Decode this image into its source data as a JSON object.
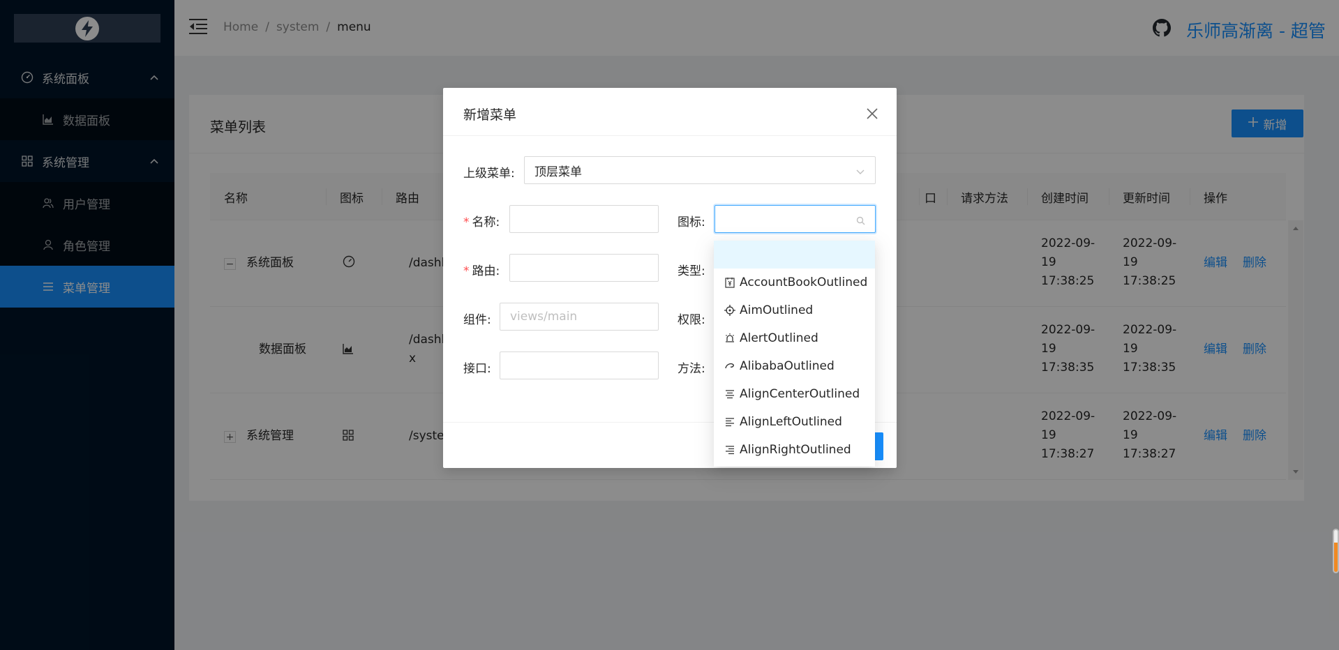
{
  "sidebar": {
    "groups": [
      {
        "label": "系统面板",
        "icon": "dashboard-icon"
      },
      {
        "label": "系统管理",
        "icon": "appstore-icon"
      }
    ],
    "items": [
      {
        "label": "数据面板",
        "icon": "area-chart-icon"
      },
      {
        "label": "用户管理",
        "icon": "team-icon"
      },
      {
        "label": "角色管理",
        "icon": "user-icon"
      },
      {
        "label": "菜单管理",
        "icon": "menu-icon"
      }
    ]
  },
  "header": {
    "breadcrumb": [
      "Home",
      "system",
      "menu"
    ],
    "separator": "/",
    "user_name": "乐师高渐离 - 超管"
  },
  "card": {
    "title": "菜单列表",
    "add_label": "新增"
  },
  "table": {
    "columns": [
      "名称",
      "图标",
      "路由",
      "口",
      "请求方法",
      "创建时间",
      "更新时间",
      "操作"
    ],
    "rows": [
      {
        "name": "系统面板",
        "expander": "−",
        "route": "/dashb",
        "route2": "",
        "created": [
          "2022-09-",
          "19",
          "17:38:25"
        ],
        "updated": [
          "2022-09-",
          "19",
          "17:38:25"
        ],
        "edit": "编辑",
        "delete": "删除"
      },
      {
        "name": "数据面板",
        "expander": "",
        "route": "/dashb",
        "route2": "x",
        "created": [
          "2022-09-",
          "19",
          "17:38:35"
        ],
        "updated": [
          "2022-09-",
          "19",
          "17:38:35"
        ],
        "edit": "编辑",
        "delete": "删除"
      },
      {
        "name": "系统管理",
        "expander": "+",
        "route": "/syster",
        "route2": "",
        "created": [
          "2022-09-",
          "19",
          "17:38:27"
        ],
        "updated": [
          "2022-09-",
          "19",
          "17:38:27"
        ],
        "edit": "编辑",
        "delete": "删除"
      }
    ]
  },
  "modal": {
    "title": "新增菜单",
    "parent_label": "上级菜单:",
    "parent_value": "顶层菜单",
    "name_label": "名称:",
    "icon_label": "图标:",
    "route_label": "路由:",
    "type_label": "类型:",
    "component_label": "组件:",
    "component_placeholder": "views/main",
    "permission_label": "权限:",
    "api_label": "接口:",
    "method_label": "方法:"
  },
  "icon_dropdown": {
    "options": [
      {
        "label": "",
        "icon": ""
      },
      {
        "label": "AccountBookOutlined",
        "icon": "account-book-icon"
      },
      {
        "label": "AimOutlined",
        "icon": "aim-icon"
      },
      {
        "label": "AlertOutlined",
        "icon": "alert-icon"
      },
      {
        "label": "AlibabaOutlined",
        "icon": "alibaba-icon"
      },
      {
        "label": "AlignCenterOutlined",
        "icon": "align-center-icon"
      },
      {
        "label": "AlignLeftOutlined",
        "icon": "align-left-icon"
      },
      {
        "label": "AlignRightOutlined",
        "icon": "align-right-icon"
      }
    ]
  },
  "colors": {
    "primary": "#1890ff",
    "sidebar_bg": "#001529",
    "submenu_bg": "#000c17",
    "required": "#ff4d4f"
  }
}
